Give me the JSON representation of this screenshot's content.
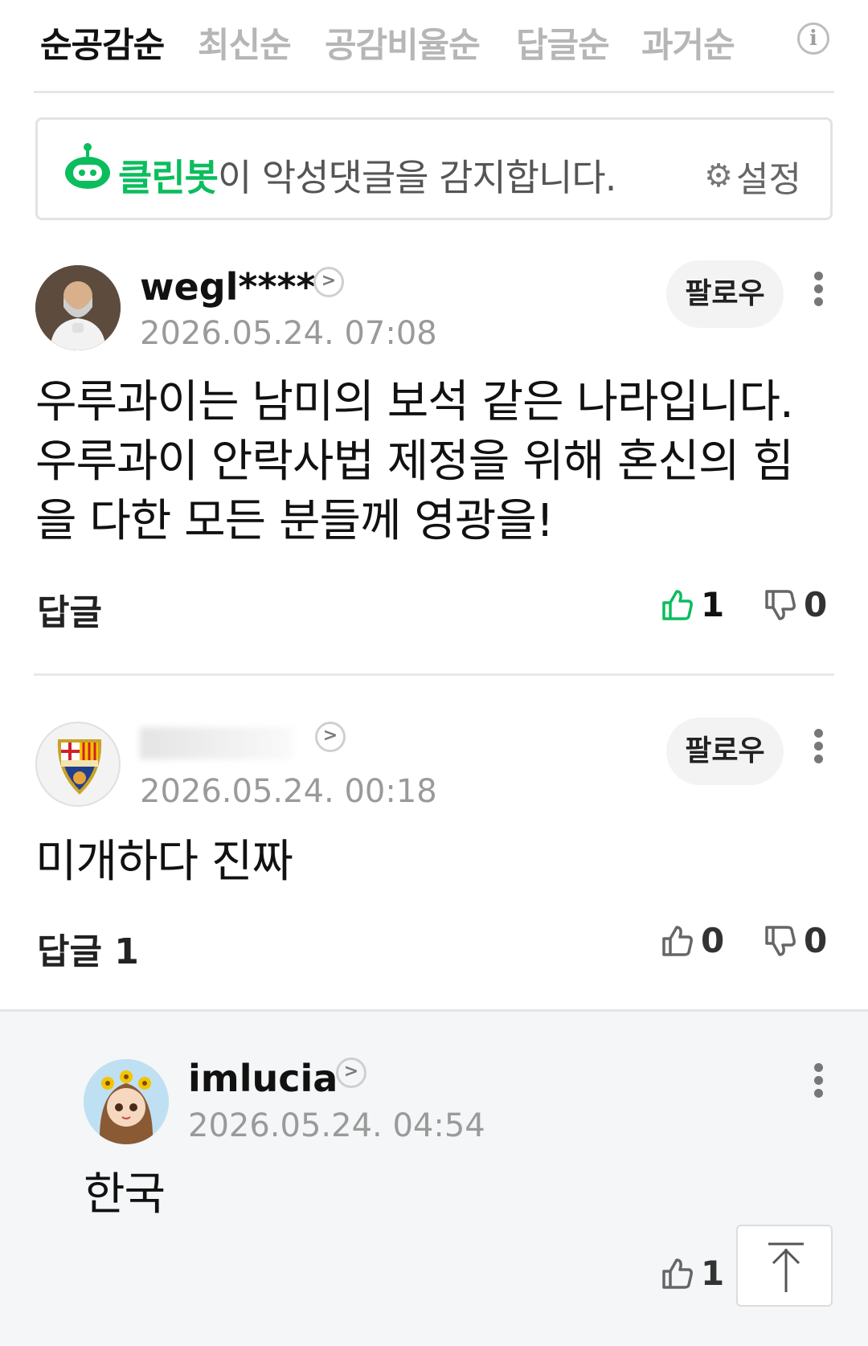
{
  "tabs": [
    {
      "label": "순공감순",
      "active": true
    },
    {
      "label": "최신순",
      "active": false
    },
    {
      "label": "공감비율순",
      "active": false
    },
    {
      "label": "답글순",
      "active": false
    },
    {
      "label": "과거순",
      "active": false
    }
  ],
  "cleanbot": {
    "name": "클린봇",
    "message": "이 악성댓글을 감지합니다.",
    "settings_label": "설정"
  },
  "comments": [
    {
      "username": "wegl****",
      "datetime": "2026.05.24. 07:08",
      "follow_label": "팔로우",
      "text": "우루과이는 남미의 보석 같은 나라입니다. 우루과이 안락사법 제정을 위해 혼신의 힘을 다한 모든 분들께 영광을!",
      "reply_label": "답글",
      "likes": "1",
      "dislikes": "0"
    },
    {
      "username": "",
      "datetime": "2026.05.24. 00:18",
      "follow_label": "팔로우",
      "text": "미개하다 진짜",
      "reply_label": "답글 1",
      "likes": "0",
      "dislikes": "0"
    }
  ],
  "reply": {
    "username": "imlucia",
    "datetime": "2026.05.24. 04:54",
    "text": "한국",
    "likes": "1"
  },
  "colors": {
    "accent_green": "#0bbd5d",
    "tab_inactive": "#b6b6b6",
    "reply_background": "#f5f6f7"
  },
  "icons": [
    "info-icon",
    "cleanbot-icon",
    "gear-icon",
    "chevron-right-icon",
    "more-vert-icon",
    "thumbs-up-icon",
    "thumbs-down-icon",
    "arrow-up-icon"
  ]
}
